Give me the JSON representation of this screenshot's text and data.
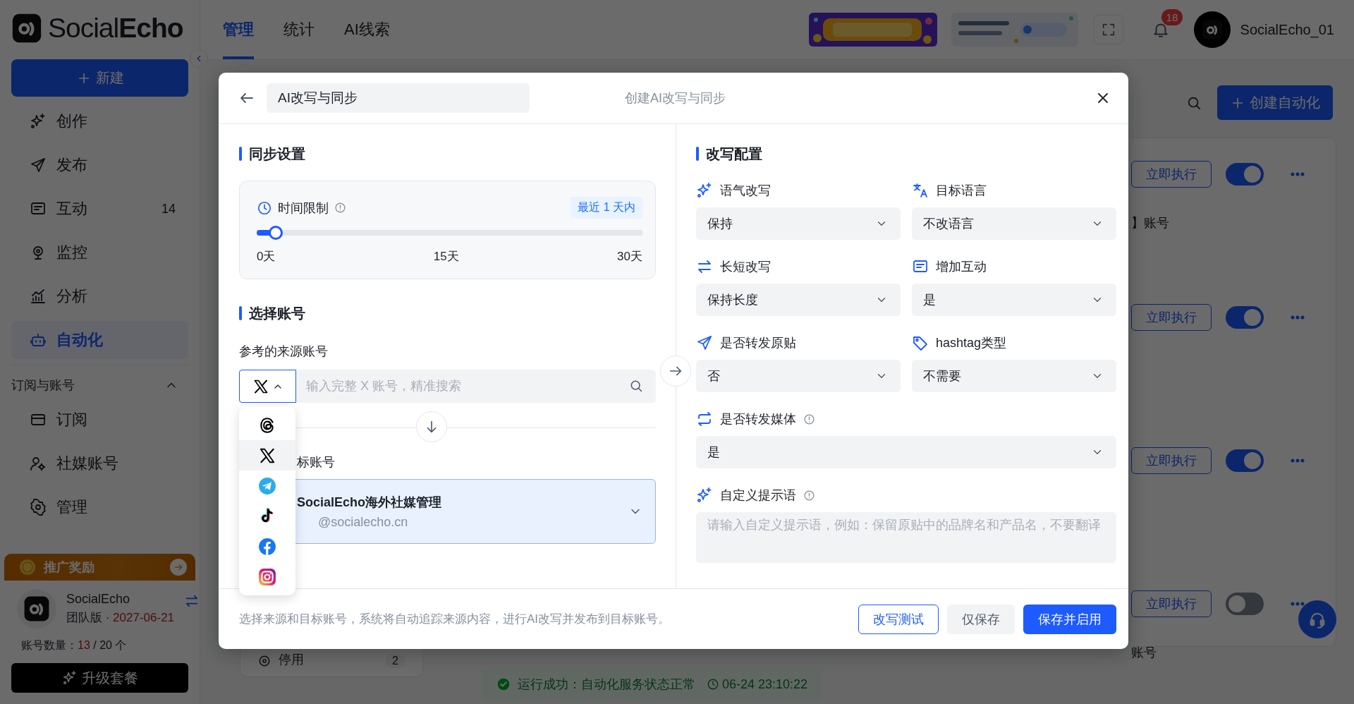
{
  "sidebar": {
    "logo": "Social**Echo**",
    "new_button": "新建",
    "nav": [
      {
        "label": "创作",
        "selected": false
      },
      {
        "label": "发布",
        "selected": false
      },
      {
        "label": "互动",
        "badge": "14",
        "selected": false
      },
      {
        "label": "监控",
        "selected": false
      },
      {
        "label": "分析",
        "selected": false
      },
      {
        "label": "自动化",
        "selected": true
      }
    ],
    "section": {
      "title": "订阅与账号",
      "expanded": true,
      "items": [
        {
          "label": "订阅",
          "selected": false
        },
        {
          "label": "社媒账号",
          "selected": false
        },
        {
          "label": "管理",
          "selected": false
        }
      ]
    },
    "promo": "推广奖励",
    "account": {
      "name": "SocialEcho",
      "plan": "团队版 ·",
      "expiry": "2027-06-21"
    },
    "quota": {
      "label": "账号数量：",
      "used": "13",
      "total": "/ 20 个"
    },
    "upgrade_button": "升级套餐"
  },
  "topbar": {
    "tabs": [
      {
        "label": "管理",
        "selected": true
      },
      {
        "label": "统计",
        "selected": false
      },
      {
        "label": "AI线索",
        "selected": false
      }
    ],
    "notifications": "18",
    "user": "SocialEcho_01"
  },
  "background": {
    "create_button": "创建自动化",
    "rows": [
      {
        "run_button": "立即执行",
        "enabled": true,
        "text": "】账号"
      },
      {
        "run_button": "立即执行",
        "enabled": true
      },
      {
        "run_button": "立即执行",
        "enabled": true
      },
      {
        "run_button": "立即执行",
        "enabled": false,
        "text": "账号"
      }
    ],
    "side_card": {
      "label": "停用",
      "count": "2"
    },
    "status": {
      "message": "运行成功：自动化服务状态正常",
      "time": "06-24 23:10:22"
    }
  },
  "modal": {
    "title": "AI改写与同步",
    "subtitle": "创建AI改写与同步",
    "sync": {
      "heading": "同步设置",
      "time_limit": {
        "label": "时间限制",
        "value": "最近 1 天内",
        "level": 0.033,
        "ticks": [
          "0天",
          "15天",
          "30天"
        ]
      }
    },
    "accounts": {
      "heading": "选择账号",
      "source_label": "参考的来源账号",
      "search_placeholder": "输入完整 X 账号，精准搜索",
      "platform_menu": {
        "expanded": true,
        "options": [
          {
            "selected": false
          },
          {
            "selected": true
          },
          {
            "selected": false
          },
          {
            "selected": false
          },
          {
            "selected": false
          },
          {
            "selected": false
          }
        ]
      },
      "target_label": "标账号",
      "target": {
        "name": "SocialEcho海外社媒管理",
        "handle": "@socialecho.cn"
      }
    },
    "rewrite": {
      "heading": "改写配置",
      "fields": [
        {
          "label": "语气改写",
          "value": "保持",
          "info": false,
          "wide": false
        },
        {
          "label": "目标语言",
          "value": "不改语言",
          "info": false,
          "wide": false
        },
        {
          "label": "长短改写",
          "value": "保持长度",
          "info": false,
          "wide": false
        },
        {
          "label": "增加互动",
          "value": "是",
          "info": false,
          "wide": false
        },
        {
          "label": "是否转发原贴",
          "value": "否",
          "info": false,
          "wide": false
        },
        {
          "label": "hashtag类型",
          "value": "不需要",
          "info": false,
          "wide": false
        },
        {
          "label": "是否转发媒体",
          "value": "是",
          "info": true,
          "wide": true
        }
      ],
      "prompt": {
        "label": "自定义提示语",
        "info": true,
        "placeholder": "请输入自定义提示语，例如：保留原贴中的品牌名和产品名，不要翻译"
      }
    },
    "footer": {
      "hint": "选择来源和目标账号，系统将自动追踪来源内容，进行AI改写并发布到目标账号。",
      "buttons": [
        {
          "label": "改写测试",
          "kind": "outline"
        },
        {
          "label": "仅保存",
          "kind": "secondary"
        },
        {
          "label": "保存并启用",
          "kind": "primary"
        }
      ]
    }
  }
}
